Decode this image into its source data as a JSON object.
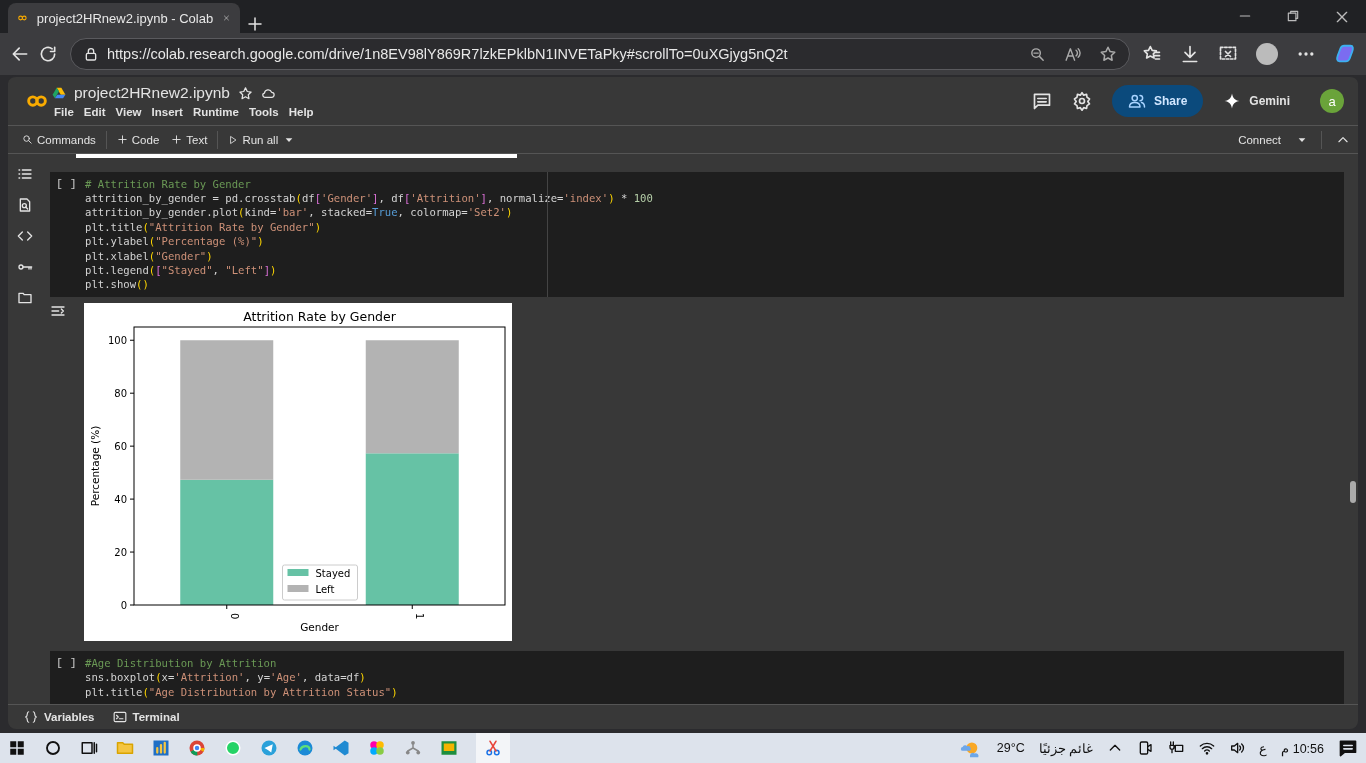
{
  "browser": {
    "tab_title": "project2HRnew2.ipynb - Colab",
    "url": "https://colab.research.google.com/drive/1n8EV98lY869R7lzkEPklbN1INVETaPky#scrollTo=0uXGjyg5nQ2t"
  },
  "notebook_header": {
    "title": "project2HRnew2.ipynb",
    "menu": [
      "File",
      "Edit",
      "View",
      "Insert",
      "Runtime",
      "Tools",
      "Help"
    ],
    "share": "Share",
    "gemini": "Gemini",
    "avatar": "a"
  },
  "toolbar": {
    "commands": "Commands",
    "add_code": "Code",
    "add_text": "Text",
    "run_all": "Run all",
    "connect": "Connect"
  },
  "cells": [
    {
      "run_marker": "[ ]",
      "lines": [
        [
          {
            "kind": "comment",
            "text": "# Attrition Rate by Gender"
          }
        ],
        [
          {
            "kind": "plain",
            "text": "attrition_by_gender = pd.crosstab"
          },
          {
            "kind": "bracket",
            "text": "("
          },
          {
            "kind": "plain",
            "text": "df"
          },
          {
            "kind": "bracket2",
            "text": "["
          },
          {
            "kind": "string",
            "text": "'Gender'"
          },
          {
            "kind": "bracket2",
            "text": "]"
          },
          {
            "kind": "plain",
            "text": ", df"
          },
          {
            "kind": "bracket2",
            "text": "["
          },
          {
            "kind": "string",
            "text": "'Attrition'"
          },
          {
            "kind": "bracket2",
            "text": "]"
          },
          {
            "kind": "plain",
            "text": ", normalize="
          },
          {
            "kind": "string",
            "text": "'index'"
          },
          {
            "kind": "bracket",
            "text": ")"
          },
          {
            "kind": "plain",
            "text": " * "
          },
          {
            "kind": "number",
            "text": "100"
          }
        ],
        [
          {
            "kind": "plain",
            "text": "attrition_by_gender.plot"
          },
          {
            "kind": "bracket",
            "text": "("
          },
          {
            "kind": "plain",
            "text": "kind="
          },
          {
            "kind": "string",
            "text": "'bar'"
          },
          {
            "kind": "plain",
            "text": ", stacked="
          },
          {
            "kind": "keyword",
            "text": "True"
          },
          {
            "kind": "plain",
            "text": ", colormap="
          },
          {
            "kind": "string",
            "text": "'Set2'"
          },
          {
            "kind": "bracket",
            "text": ")"
          }
        ],
        [
          {
            "kind": "plain",
            "text": "plt.title"
          },
          {
            "kind": "bracket",
            "text": "("
          },
          {
            "kind": "string",
            "text": "\"Attrition Rate by Gender\""
          },
          {
            "kind": "bracket",
            "text": ")"
          }
        ],
        [
          {
            "kind": "plain",
            "text": "plt.ylabel"
          },
          {
            "kind": "bracket",
            "text": "("
          },
          {
            "kind": "string",
            "text": "\"Percentage (%)\""
          },
          {
            "kind": "bracket",
            "text": ")"
          }
        ],
        [
          {
            "kind": "plain",
            "text": "plt.xlabel"
          },
          {
            "kind": "bracket",
            "text": "("
          },
          {
            "kind": "string",
            "text": "\"Gender\""
          },
          {
            "kind": "bracket",
            "text": ")"
          }
        ],
        [
          {
            "kind": "plain",
            "text": "plt.legend"
          },
          {
            "kind": "bracket",
            "text": "("
          },
          {
            "kind": "bracket2",
            "text": "["
          },
          {
            "kind": "string",
            "text": "\"Stayed\""
          },
          {
            "kind": "plain",
            "text": ", "
          },
          {
            "kind": "string",
            "text": "\"Left\""
          },
          {
            "kind": "bracket2",
            "text": "]"
          },
          {
            "kind": "bracket",
            "text": ")"
          }
        ],
        [
          {
            "kind": "plain",
            "text": "plt.show"
          },
          {
            "kind": "bracket",
            "text": "()"
          }
        ]
      ],
      "output": {
        "chart_data": {
          "type": "bar",
          "stacked": true,
          "legend": "lower center",
          "title": "Attrition Rate by Gender",
          "xlabel": "Gender",
          "ylabel": "Percentage (%)",
          "categories": [
            "0",
            "1"
          ],
          "ylim": [
            0,
            105
          ],
          "yticks": [
            0,
            20,
            40,
            60,
            80,
            100
          ],
          "series": [
            {
              "name": "Stayed",
              "color": "#66c2a5",
              "values": [
                47.3,
                57.3
              ]
            },
            {
              "name": "Left",
              "color": "#b3b3b3",
              "values": [
                52.7,
                42.7
              ]
            }
          ]
        }
      }
    },
    {
      "run_marker": "[ ]",
      "lines": [
        [
          {
            "kind": "comment",
            "text": "#Age Distribution by Attrition"
          }
        ],
        [
          {
            "kind": "plain",
            "text": "sns.boxplot"
          },
          {
            "kind": "bracket",
            "text": "("
          },
          {
            "kind": "plain",
            "text": "x="
          },
          {
            "kind": "string",
            "text": "'Attrition'"
          },
          {
            "kind": "plain",
            "text": ", y="
          },
          {
            "kind": "string",
            "text": "'Age'"
          },
          {
            "kind": "plain",
            "text": ", data=df"
          },
          {
            "kind": "bracket",
            "text": ")"
          }
        ],
        [
          {
            "kind": "plain",
            "text": "plt.title"
          },
          {
            "kind": "bracket",
            "text": "("
          },
          {
            "kind": "string",
            "text": "\"Age Distribution by Attrition Status\""
          },
          {
            "kind": "bracket",
            "text": ")"
          }
        ]
      ]
    }
  ],
  "bottom_bar": {
    "variables": "Variables",
    "terminal": "Terminal"
  },
  "taskbar": {
    "temperature": "29°C",
    "weather": "غائم جزئيًا",
    "language": "ع",
    "clock": "10:56 م"
  }
}
